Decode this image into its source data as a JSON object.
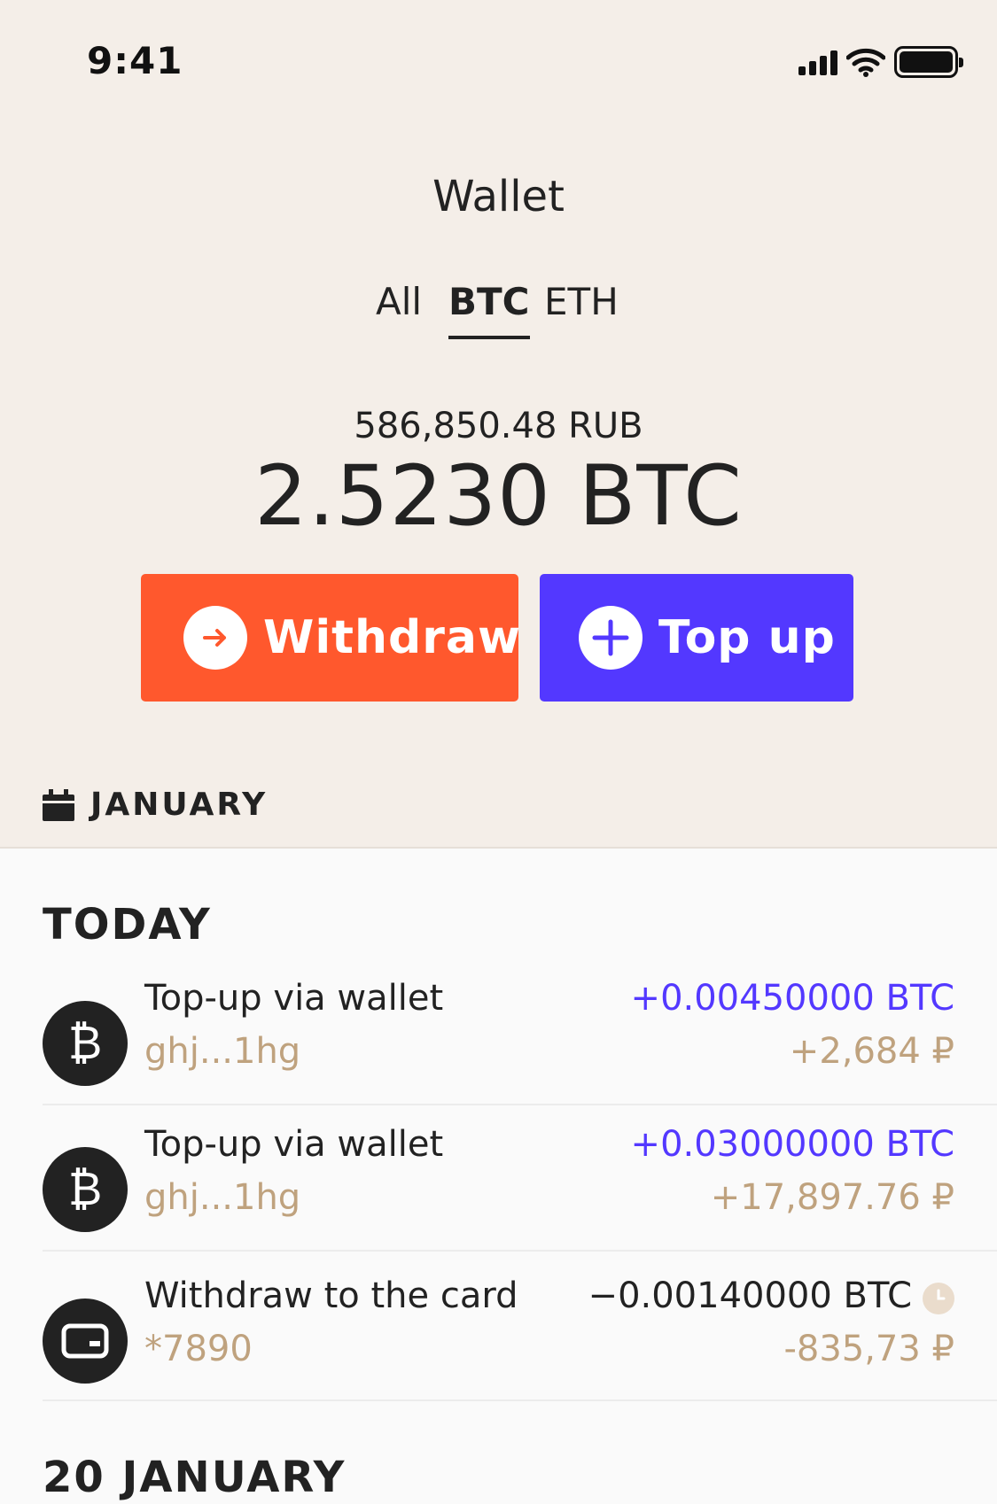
{
  "status_bar": {
    "time": "9:41"
  },
  "header": {
    "title": "Wallet",
    "tabs": [
      {
        "label": "All",
        "active": false
      },
      {
        "label": "BTC",
        "active": true
      },
      {
        "label": "ETH",
        "active": false
      }
    ]
  },
  "balance": {
    "fiat": "586,850.48 RUB",
    "crypto": "2.5230 BTC"
  },
  "actions": {
    "withdraw_label": "Withdraw",
    "topup_label": "Top up"
  },
  "month_label": "JANUARY",
  "groups": [
    {
      "title": "TODAY",
      "transactions": [
        {
          "icon": "bitcoin-icon",
          "title": "Top-up via wallet",
          "subtitle": "ghj...1hg",
          "amount": "+0.00450000 BTC",
          "fiat": "+2,684 ₽"
        },
        {
          "icon": "bitcoin-icon",
          "title": "Top-up via wallet",
          "subtitle": "ghj...1hg",
          "amount": "+0.03000000 BTC",
          "fiat": "+17,897.76 ₽"
        },
        {
          "icon": "card-icon",
          "title": "Withdraw to the card",
          "subtitle": "*7890",
          "amount": "−0.00140000 BTC",
          "fiat": "-835,73 ₽",
          "pending": true
        }
      ]
    },
    {
      "title": "20 JANUARY",
      "transactions": []
    }
  ],
  "colors": {
    "header_bg": "#f4eee8",
    "withdraw": "#ff582d",
    "topup": "#5338ff",
    "income": "#5338ff",
    "muted": "#bfa27e"
  }
}
